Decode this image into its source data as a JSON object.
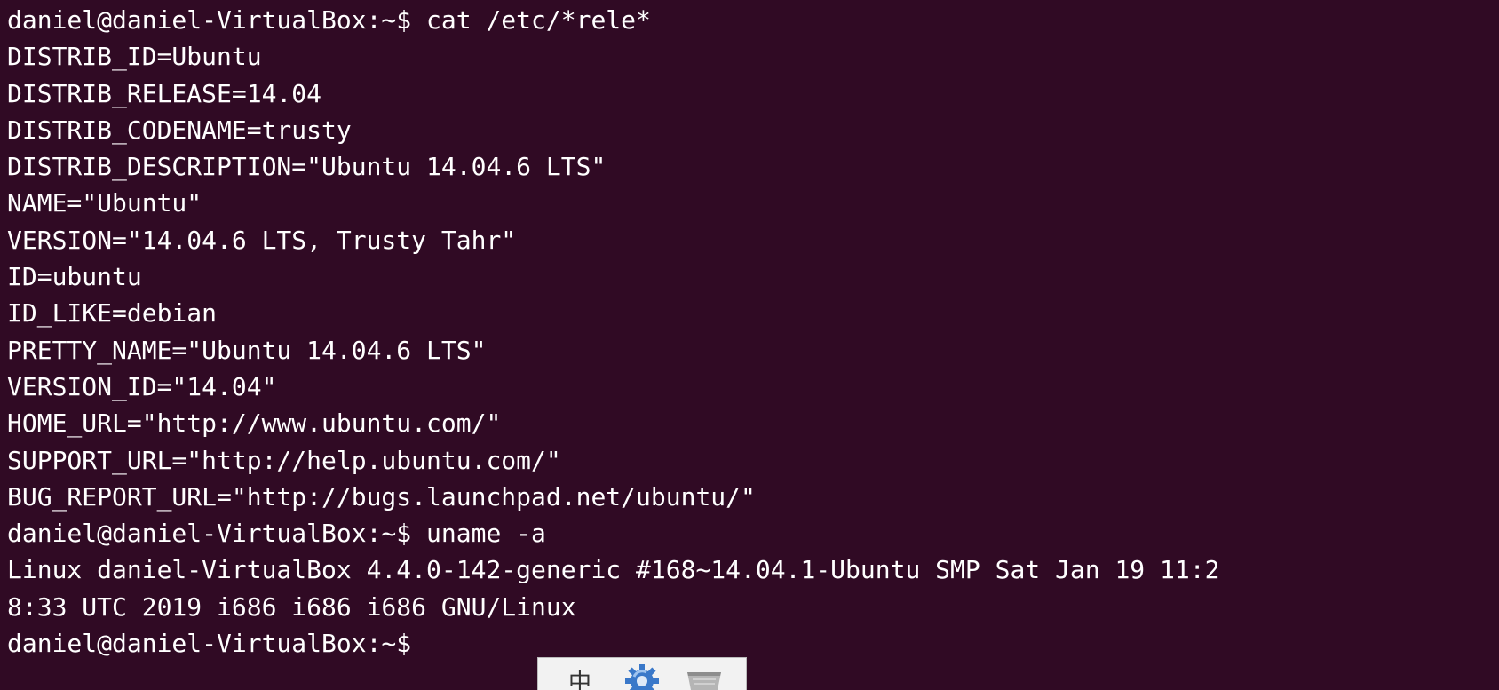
{
  "terminal": {
    "lines": [
      "daniel@daniel-VirtualBox:~$ cat /etc/*rele*",
      "DISTRIB_ID=Ubuntu",
      "DISTRIB_RELEASE=14.04",
      "DISTRIB_CODENAME=trusty",
      "DISTRIB_DESCRIPTION=\"Ubuntu 14.04.6 LTS\"",
      "NAME=\"Ubuntu\"",
      "VERSION=\"14.04.6 LTS, Trusty Tahr\"",
      "ID=ubuntu",
      "ID_LIKE=debian",
      "PRETTY_NAME=\"Ubuntu 14.04.6 LTS\"",
      "VERSION_ID=\"14.04\"",
      "HOME_URL=\"http://www.ubuntu.com/\"",
      "SUPPORT_URL=\"http://help.ubuntu.com/\"",
      "BUG_REPORT_URL=\"http://bugs.launchpad.net/ubuntu/\"",
      "daniel@daniel-VirtualBox:~$ uname -a",
      "Linux daniel-VirtualBox 4.4.0-142-generic #168~14.04.1-Ubuntu SMP Sat Jan 19 11:2",
      "8:33 UTC 2019 i686 i686 i686 GNU/Linux",
      "daniel@daniel-VirtualBox:~$ "
    ],
    "background_color": "#300a24",
    "text_color": "#ffffff"
  },
  "tray": {
    "icons": [
      {
        "name": "input-method-icon",
        "glyph": "中"
      },
      {
        "name": "gear-icon"
      },
      {
        "name": "keyboard-icon"
      }
    ]
  }
}
